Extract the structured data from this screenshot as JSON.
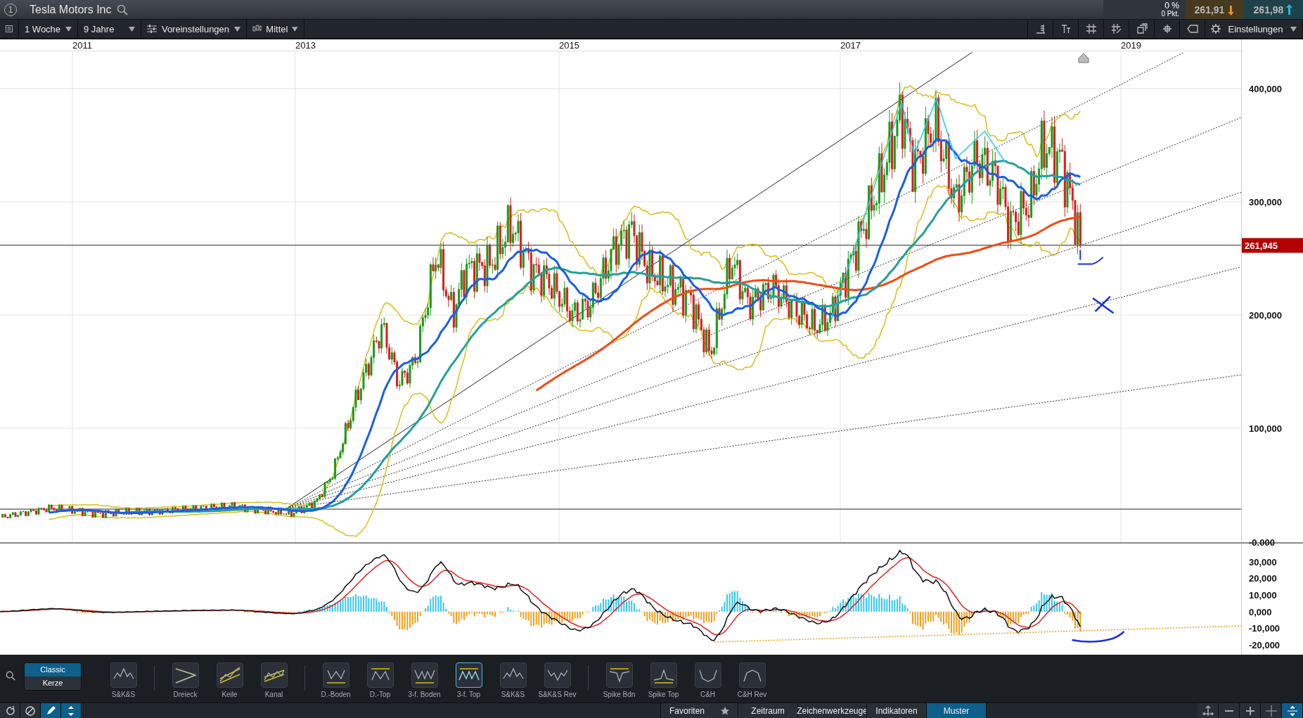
{
  "header": {
    "window_number": "1",
    "title": "Tesla Motors Inc",
    "change_percent": "0 %",
    "change_points": "0 Pkt.",
    "bid": "261,91",
    "ask": "261,98"
  },
  "toolbar": {
    "interval": "1 Woche",
    "range": "9 Jahre",
    "presets": "Voreinstellungen",
    "style": "Mittel",
    "settings": "Einstellungen"
  },
  "chart": {
    "x_labels": [
      "2011",
      "2013",
      "2015",
      "2017",
      "2019"
    ],
    "y_labels": [
      "400,000",
      "300,000",
      "200,000",
      "100,000",
      "-0.000"
    ],
    "last_price": "261,945",
    "macd_labels": [
      "30,000",
      "20,000",
      "10,000",
      "0,000",
      "-10,000",
      "-20,000"
    ]
  },
  "chart_types": [
    {
      "label": "Classic",
      "selected": true
    },
    {
      "label": "Kerze",
      "selected": false
    }
  ],
  "pattern_groups": [
    [
      {
        "label": "S&K&S",
        "kind": "hs",
        "selected": false
      }
    ],
    [
      {
        "label": "Dreieck",
        "kind": "triangle",
        "selected": false
      },
      {
        "label": "Keile",
        "kind": "wedge",
        "selected": false
      },
      {
        "label": "Kanal",
        "kind": "channel",
        "selected": false
      }
    ],
    [
      {
        "label": "D.-Boden",
        "kind": "dbottom",
        "selected": false
      },
      {
        "label": "D.-Top",
        "kind": "dtop",
        "selected": false
      },
      {
        "label": "3-f. Boden",
        "kind": "tbottom",
        "selected": false
      },
      {
        "label": "3-f. Top",
        "kind": "ttop",
        "selected": true
      },
      {
        "label": "S&K&S",
        "kind": "hs",
        "selected": false
      },
      {
        "label": "S&K&S Rev",
        "kind": "hsrev",
        "selected": false
      }
    ],
    [
      {
        "label": "Spike Bdn",
        "kind": "spikebottom",
        "selected": false
      },
      {
        "label": "Spike Top",
        "kind": "spiketop",
        "selected": false
      },
      {
        "label": "C&H",
        "kind": "cup",
        "selected": false
      },
      {
        "label": "C&H Rev",
        "kind": "cuprev",
        "selected": false
      }
    ]
  ],
  "tools": [
    {
      "kind": "refresh",
      "selected": false
    },
    {
      "kind": "block",
      "selected": false
    },
    {
      "kind": "pencil",
      "selected": true
    },
    {
      "kind": "arrows",
      "selected": true
    }
  ],
  "bottom_tabs": [
    {
      "label": "Favoriten",
      "selected": false,
      "starred": true
    },
    {
      "label": "Zeitraum",
      "selected": false,
      "starred": false
    },
    {
      "label": "Zeichenwerkzeuge",
      "selected": false,
      "starred": false
    },
    {
      "label": "Indikatoren",
      "selected": false,
      "starred": false
    },
    {
      "label": "Muster",
      "selected": true,
      "starred": false
    }
  ],
  "zoom_controls": [
    {
      "kind": "pan",
      "selected": false
    },
    {
      "kind": "minus",
      "selected": false
    },
    {
      "kind": "plus",
      "selected": false
    },
    {
      "kind": "crosshair",
      "selected": false
    },
    {
      "kind": "fit",
      "selected": true
    }
  ]
}
